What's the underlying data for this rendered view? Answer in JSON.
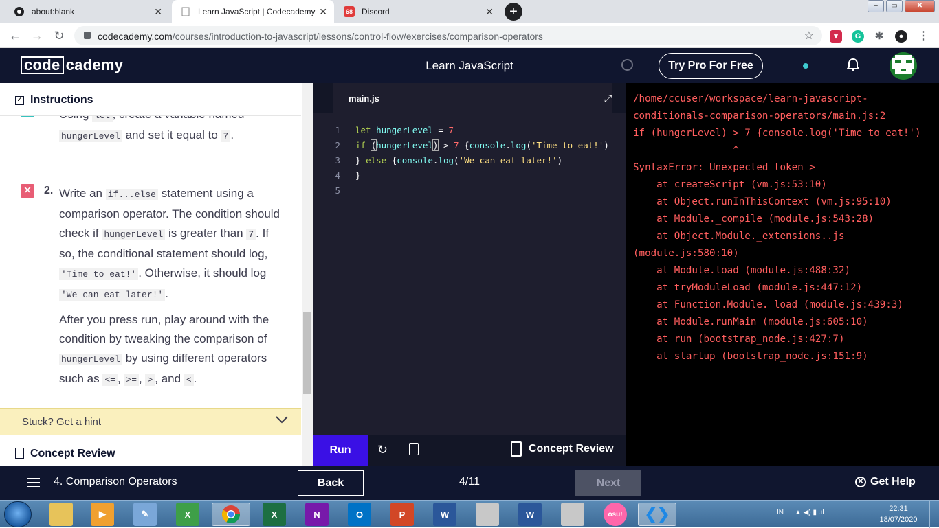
{
  "browser": {
    "tabs": [
      {
        "label": "about:blank",
        "icon": "chrome-icon"
      },
      {
        "label": "Learn JavaScript | Codecademy",
        "icon": "codecademy-icon"
      },
      {
        "label": "Discord",
        "icon": "discord-icon",
        "badge": "68"
      }
    ],
    "url_domain": "codecademy.com",
    "url_path": "/courses/introduction-to-javascript/lessons/control-flow/exercises/comparison-operators"
  },
  "header": {
    "logo_code": "code",
    "logo_cademy": "cademy",
    "course_title": "Learn JavaScript",
    "try_pro": "Try Pro For Free"
  },
  "instructions": {
    "heading": "Instructions",
    "step1_cut": "Using",
    "step1_code1": "let",
    "step1_cut2": ", create a variable named",
    "step1_code2": "hungerLevel",
    "step1_mid": "and set it equal to",
    "step1_code3": "7",
    "step2_num": "2.",
    "step2_t1": "Write an",
    "step2_c1": "if...else",
    "step2_t2": "statement using a comparison operator. The condition should check if",
    "step2_c2": "hungerLevel",
    "step2_t3": "is greater than",
    "step2_c3": "7",
    "step2_t4": ". If so, the conditional statement should log,",
    "step2_c4": "'Time to eat!'",
    "step2_t5": ". Otherwise, it should log",
    "step2_c5": "'We can eat later!'",
    "p3_t1": "After you press run, play around with the condition by tweaking the comparison of",
    "p3_c1": "hungerLevel",
    "p3_t2": "by using different operators such as",
    "p3_c2": "<=",
    "p3_c3": ">=",
    "p3_c4": ">",
    "p3_t3": ", and",
    "p3_c5": "<",
    "hint": "Stuck? Get a hint",
    "concept_review": "Concept Review"
  },
  "editor": {
    "filename": "main.js",
    "line_numbers": [
      "1",
      "2",
      "3",
      "4",
      "5"
    ],
    "run_label": "Run",
    "concept_review": "Concept Review"
  },
  "terminal": {
    "lines": [
      "/home/ccuser/workspace/learn-javascript-",
      "conditionals-comparison-operators/main.js:2",
      "if (hungerLevel) > 7 {console.log('Time to eat!')",
      "                 ^",
      "SyntaxError: Unexpected token >",
      "    at createScript (vm.js:53:10)",
      "    at Object.runInThisContext (vm.js:95:10)",
      "    at Module._compile (module.js:543:28)",
      "    at Object.Module._extensions..js",
      "(module.js:580:10)",
      "    at Module.load (module.js:488:32)",
      "    at tryModuleLoad (module.js:447:12)",
      "    at Function.Module._load (module.js:439:3)",
      "    at Module.runMain (module.js:605:10)",
      "    at run (bootstrap_node.js:427:7)",
      "    at startup (bootstrap_node.js:151:9)"
    ]
  },
  "footer": {
    "lesson": "4. Comparison Operators",
    "back": "Back",
    "progress": "4/11",
    "next": "Next",
    "help": "Get Help"
  },
  "taskbar": {
    "lang": "IN",
    "time": "22:31",
    "date": "18/07/2020",
    "apps": [
      "explorer-icon",
      "media-player-icon",
      "paint-icon",
      "excel-icon",
      "chrome-icon",
      "excel-icon",
      "onenote-icon",
      "outlook-icon",
      "powerpoint-icon",
      "word-icon",
      "roblox-icon",
      "word-icon",
      "roblox-icon",
      "osu-icon",
      "vscode-icon"
    ],
    "osu_label": "osu!"
  },
  "colors": {
    "codecademy_navy": "#10162f",
    "run_purple": "#3a10e5",
    "terminal_error": "#ff5e5e",
    "hint_yellow": "#faf0be"
  }
}
